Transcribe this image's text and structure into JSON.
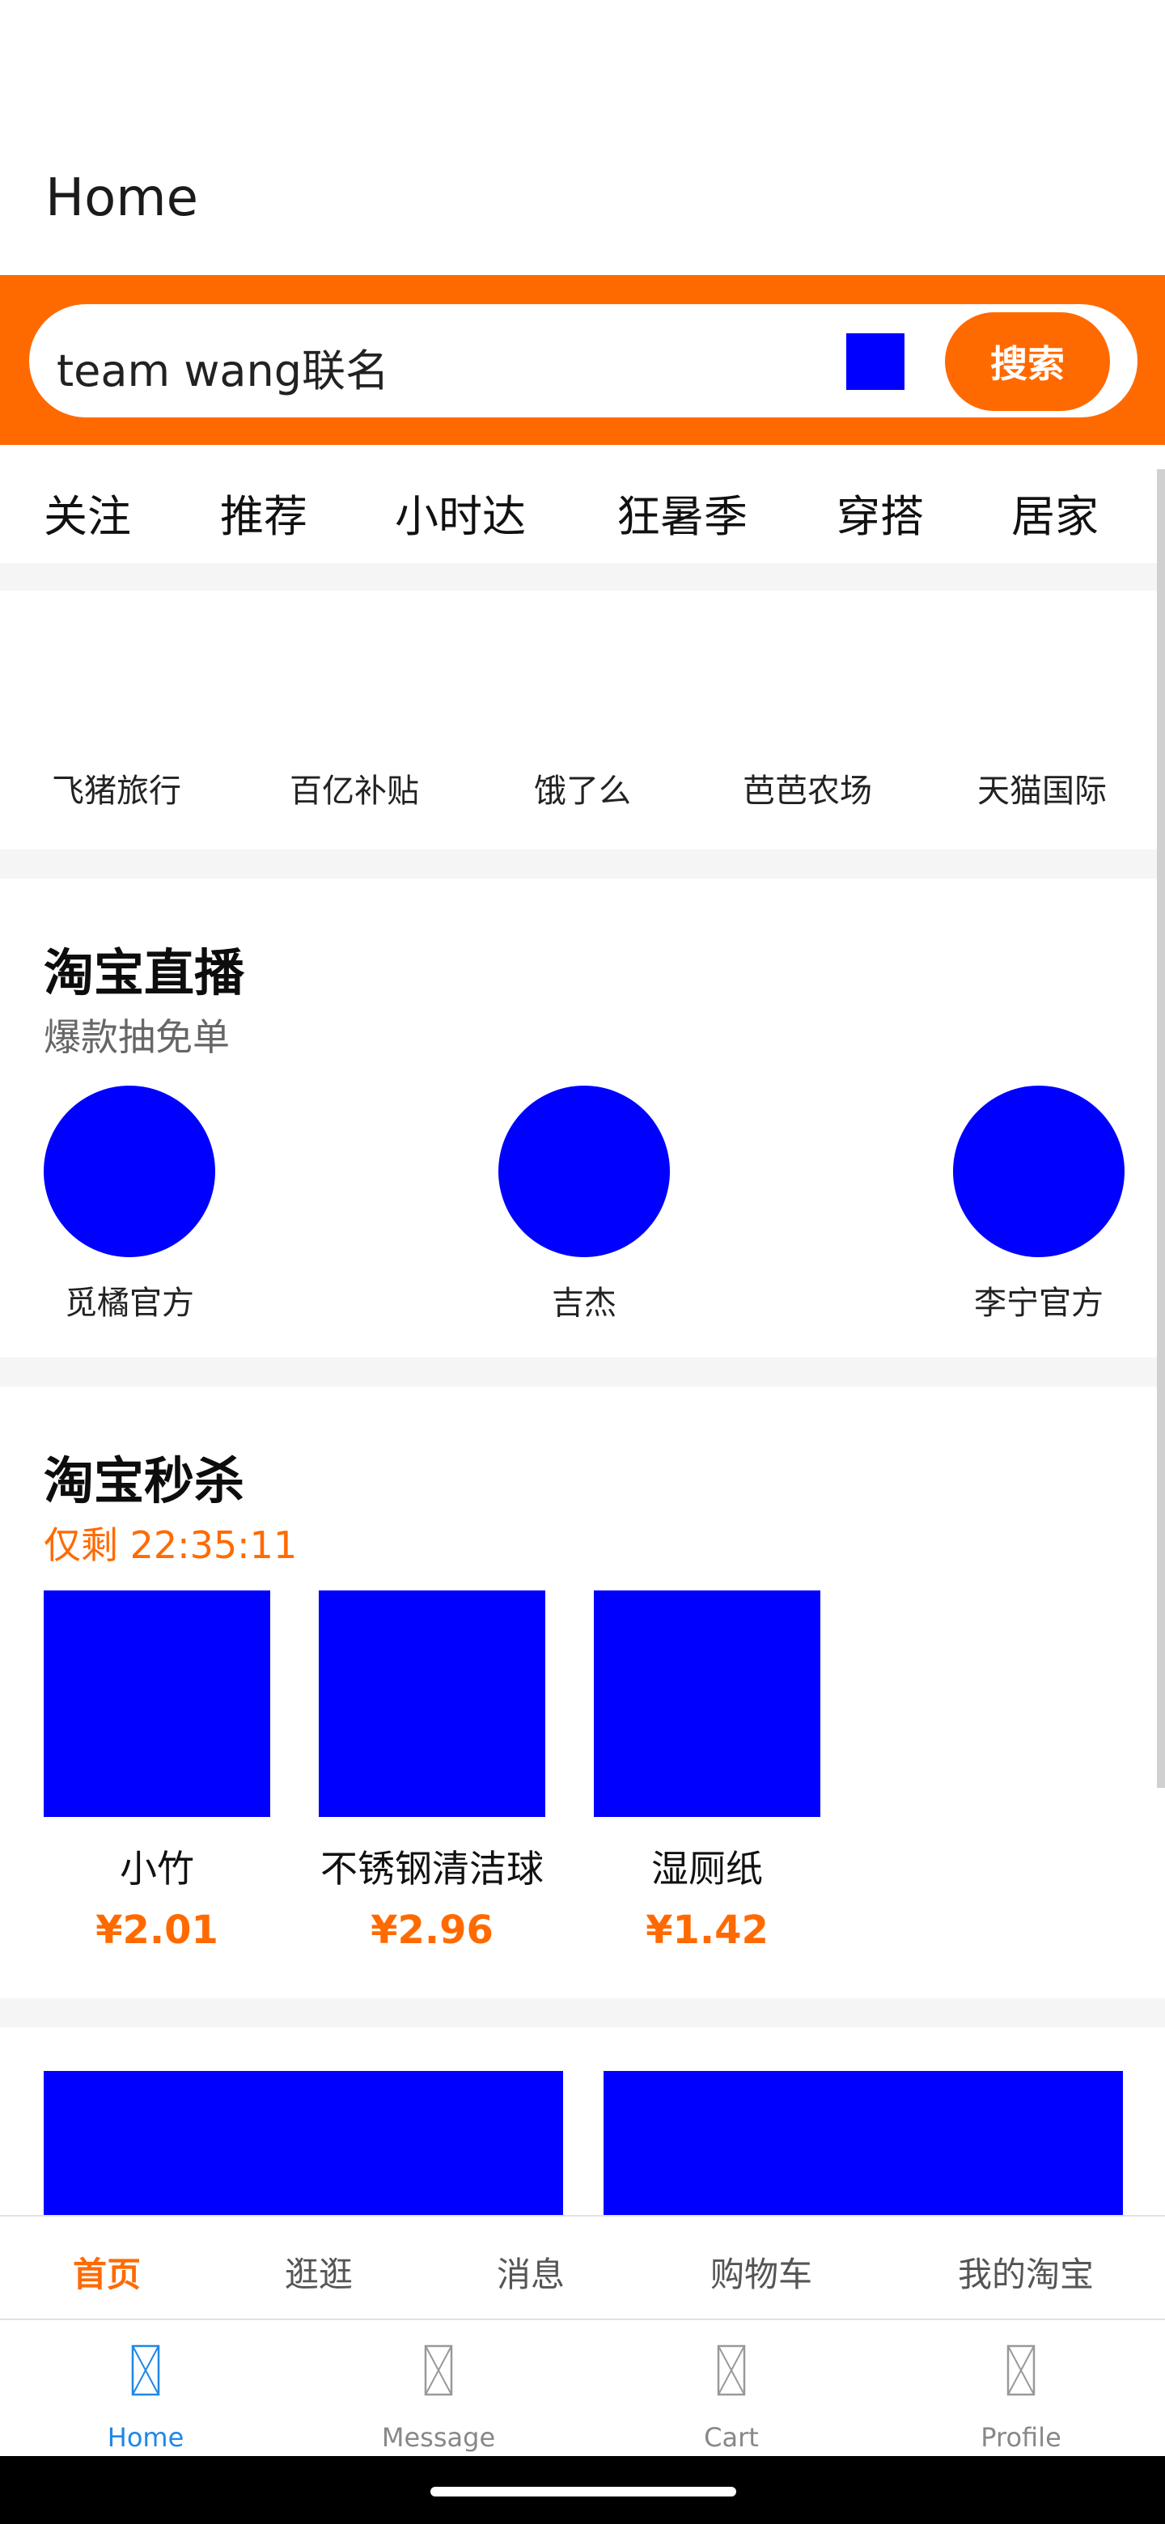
{
  "header": {
    "title": "Home"
  },
  "search": {
    "query": "team wang联名",
    "button_label": "搜索",
    "accent": "#ff6a00"
  },
  "tabs": [
    "关注",
    "推荐",
    "小时达",
    "狂暑季",
    "穿搭",
    "居家"
  ],
  "quick_links": [
    "飞猪旅行",
    "百亿补贴",
    "饿了么",
    "芭芭农场",
    "天猫国际"
  ],
  "live": {
    "title": "淘宝直播",
    "subtitle": "爆款抽免单",
    "items": [
      {
        "name": "觅橘官方"
      },
      {
        "name": "吉杰"
      },
      {
        "name": "李宁官方"
      }
    ]
  },
  "flash_sale": {
    "title": "淘宝秒杀",
    "countdown": "仅剩 22:35:11",
    "items": [
      {
        "name": "小竹",
        "price": "¥2.01"
      },
      {
        "name": "不锈钢清洁球",
        "price": "¥2.96"
      },
      {
        "name": "湿厕纸",
        "price": "¥1.42"
      }
    ]
  },
  "sub_nav": [
    "首页",
    "逛逛",
    "消息",
    "购物车",
    "我的淘宝"
  ],
  "bottom_nav": [
    {
      "label": "Home",
      "icon": "home-icon",
      "active": true
    },
    {
      "label": "Message",
      "icon": "message-icon",
      "active": false
    },
    {
      "label": "Cart",
      "icon": "cart-icon",
      "active": false
    },
    {
      "label": "Profile",
      "icon": "profile-icon",
      "active": false
    }
  ],
  "colors": {
    "accent": "#ff6a00",
    "placeholder_image": "#0000ff",
    "active_tab": "#1e88e5"
  }
}
